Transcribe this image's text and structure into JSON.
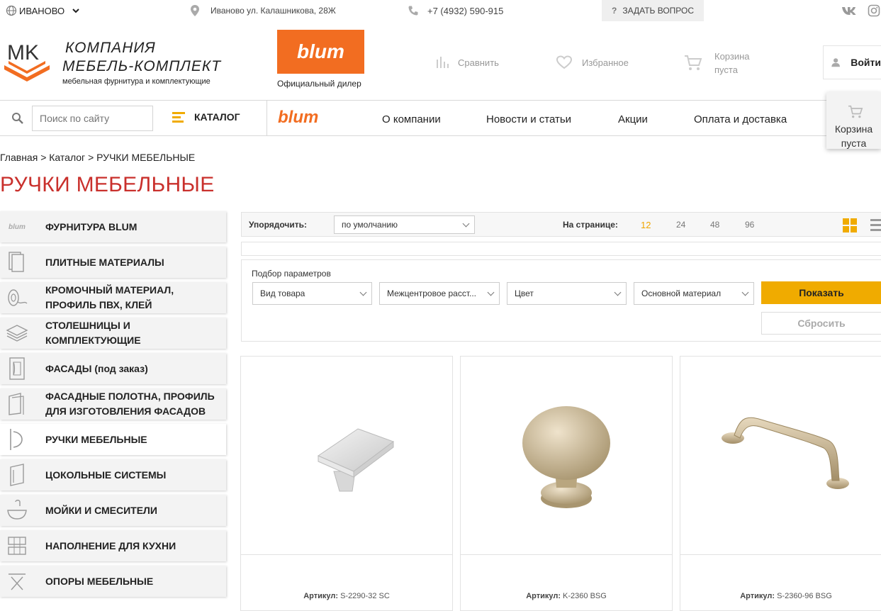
{
  "topbar": {
    "city": "ИВАНОВО",
    "address": "Иваново ул. Калашникова, 28Ж",
    "phone": "+7 (4932) 590-915",
    "ask": "ЗАДАТЬ ВОПРОС"
  },
  "header": {
    "company_line1": "КОМПАНИЯ",
    "company_line2": "МЕБЕЛЬ-КОМПЛЕКТ",
    "company_tagline": "мебельная фурнитура и комплектующие",
    "blum_logo": "blum",
    "dealer": "Официальный дилер",
    "compare": "Сравнить",
    "favorites": "Избранное",
    "cart_line1": "Корзина",
    "cart_line2": "пуста",
    "login": "Войти"
  },
  "nav": {
    "search_placeholder": "Поиск по сайту",
    "catalog": "КАТАЛОГ",
    "blum": "blum",
    "links": [
      "О компании",
      "Новости и статьи",
      "Акции",
      "Оплата и доставка"
    ],
    "cart_line1": "Корзина",
    "cart_line2": "пуста"
  },
  "breadcrumb": [
    "Главная",
    "Каталог",
    "РУЧКИ МЕБЕЛЬНЫЕ"
  ],
  "breadcrumb_sep": ">",
  "page_title": "РУЧКИ МЕБЕЛЬНЫЕ",
  "sidebar": {
    "items": [
      {
        "label": "ФУРНИТУРА BLUM",
        "icon": "blum-icon"
      },
      {
        "label": "ПЛИТНЫЕ МАТЕРИАЛЫ",
        "icon": "panels-icon"
      },
      {
        "label": "КРОМОЧНЫЙ МАТЕРИАЛ,",
        "label2": "ПРОФИЛЬ ПВХ, КЛЕЙ",
        "icon": "edge-roll-icon"
      },
      {
        "label": "СТОЛЕШНИЦЫ И",
        "label2": "КОМПЛЕКТУЮЩИЕ",
        "icon": "countertop-icon"
      },
      {
        "label": "ФАСАДЫ (под заказ)",
        "icon": "facade-icon"
      },
      {
        "label": "ФАСАДНЫЕ ПОЛОТНА, ПРОФИЛЬ",
        "label2": "ДЛЯ ИЗГОТОВЛЕНИЯ ФАСАДОВ",
        "icon": "facade-panel-icon"
      },
      {
        "label": "РУЧКИ МЕБЕЛЬНЫЕ",
        "icon": "handle-icon"
      },
      {
        "label": "ЦОКОЛЬНЫЕ СИСТЕМЫ",
        "icon": "plinth-icon"
      },
      {
        "label": "МОЙКИ И СМЕСИТЕЛИ",
        "icon": "sink-icon"
      },
      {
        "label": "НАПОЛНЕНИЕ ДЛЯ КУХНИ",
        "icon": "basket-icon"
      },
      {
        "label": "ОПОРЫ МЕБЕЛЬНЫЕ",
        "icon": "leg-icon"
      }
    ]
  },
  "sort": {
    "label": "Упорядочить:",
    "value": "по умолчанию",
    "per_page_label": "На странице:",
    "per_page": [
      "12",
      "24",
      "48",
      "96"
    ],
    "per_page_selected": "12"
  },
  "filter": {
    "title": "Подбор параметров",
    "selects": [
      "Вид товара",
      "Межцентровое расст...",
      "Цвет",
      "Основной материал"
    ],
    "show": "Показать",
    "reset": "Сбросить"
  },
  "products": [
    {
      "sku_label": "Артикул:",
      "sku": "S-2290-32 SC"
    },
    {
      "sku_label": "Артикул:",
      "sku": "K-2360 BSG"
    },
    {
      "sku_label": "Артикул:",
      "sku": "S-2360-96 BSG"
    }
  ],
  "colors": {
    "accent_red": "#c9302c",
    "blum_orange": "#f26d21",
    "button_yellow": "#f0ab00"
  }
}
